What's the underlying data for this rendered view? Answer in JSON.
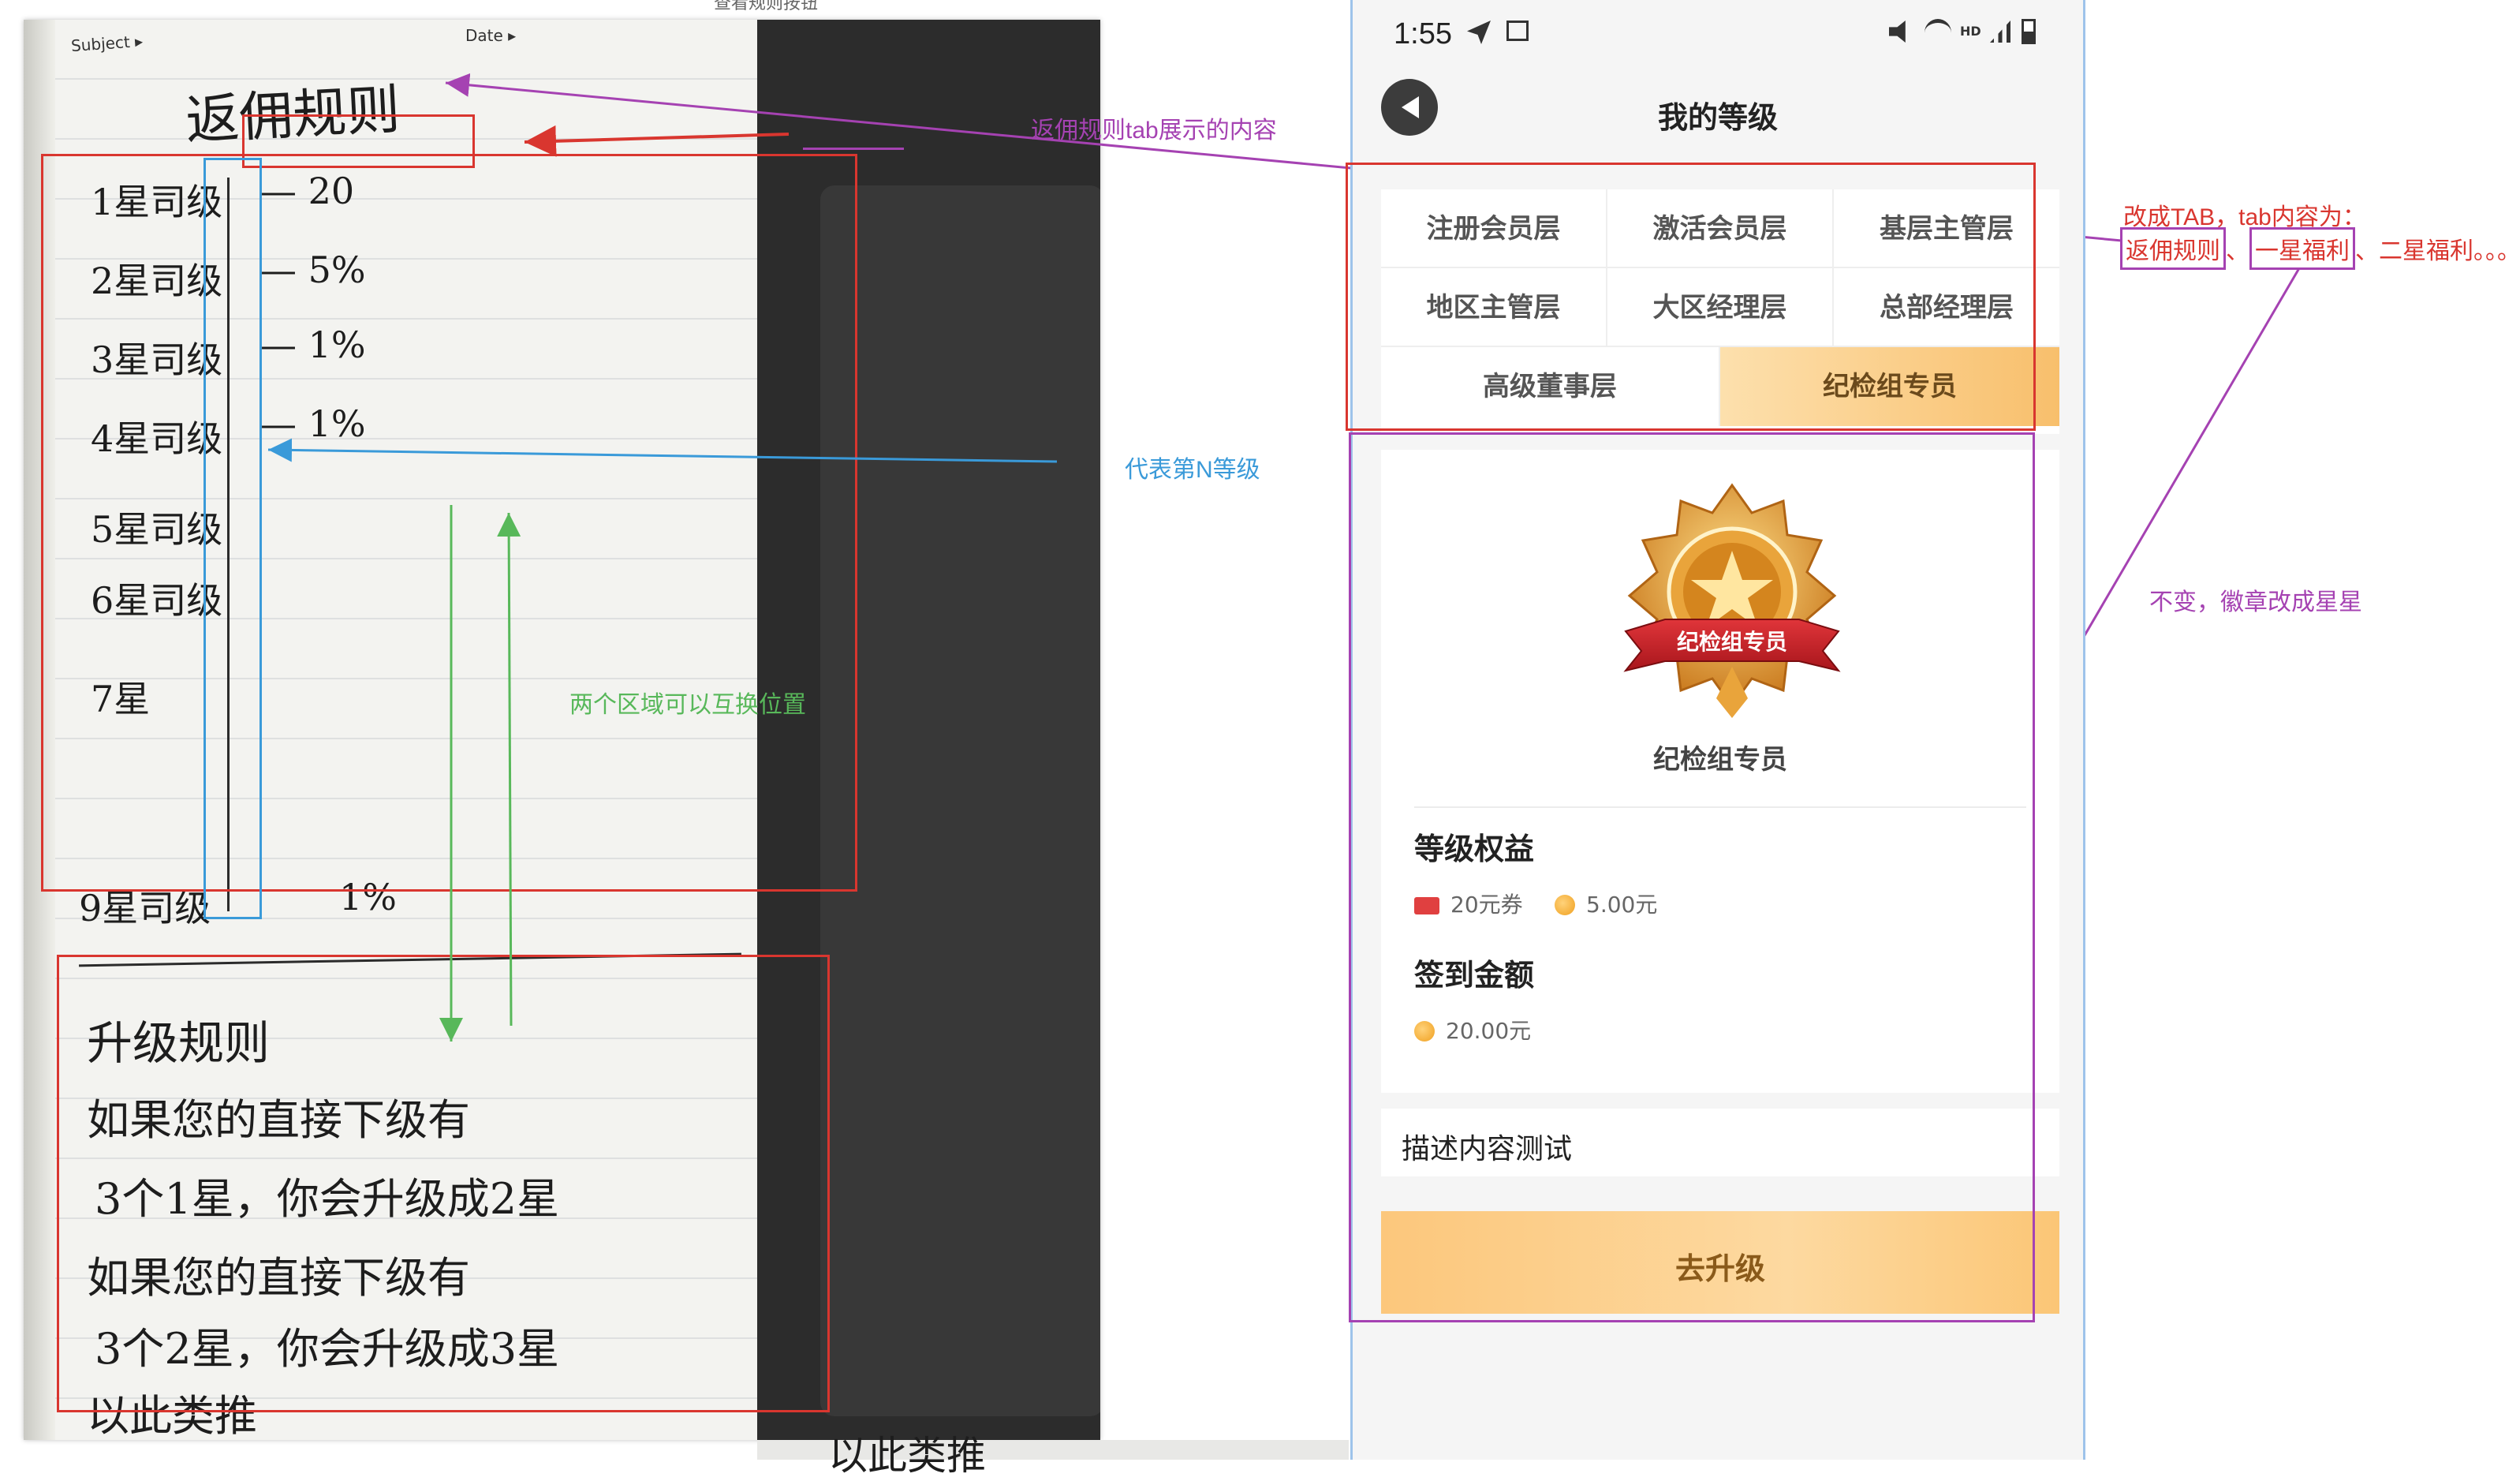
{
  "top_caption": "查看规则按钮",
  "notebook": {
    "subject_label": "Subject ▸",
    "date_label": "Date ▸",
    "heading": "返佣规则",
    "levels": [
      {
        "label": "1星司级",
        "value": "— 20"
      },
      {
        "label": "2星司级",
        "value": "— 5%"
      },
      {
        "label": "3星司级",
        "value": "— 1%"
      },
      {
        "label": "4星司级",
        "value": "— 1%"
      },
      {
        "label": "5星司级",
        "value": ""
      },
      {
        "label": "6星司级",
        "value": ""
      },
      {
        "label": "7星",
        "value": ""
      },
      {
        "label": "9星司级",
        "value": "1%"
      }
    ],
    "upgrade_heading": "升级规则",
    "upgrade_lines": [
      "如果您的直接下级有",
      "3个1星，你会升级成2星",
      "如果您的直接下级有",
      "3个2星，你会升级成3星",
      "以此类推"
    ],
    "bottom_partial": "以此类推"
  },
  "annotations": {
    "rule_tab_content": "返佣规则tab展示的内容",
    "nth_level": "代表第N等级",
    "swap_areas": "两个区域可以互换位置",
    "change_tab_line1": "改成TAB，tab内容为：",
    "change_tab_line2_parts": [
      "返佣规则",
      "、",
      "一星福利",
      "、二星福利。。。"
    ],
    "badge_note": "不变，徽章改成星星"
  },
  "phone": {
    "status": {
      "time": "1:55",
      "hd": "HD"
    },
    "title": "我的等级",
    "tabs": [
      {
        "label": "注册会员层",
        "active": false
      },
      {
        "label": "激活会员层",
        "active": false
      },
      {
        "label": "基层主管层",
        "active": false
      },
      {
        "label": "地区主管层",
        "active": false
      },
      {
        "label": "大区经理层",
        "active": false
      },
      {
        "label": "总部经理层",
        "active": false
      },
      {
        "label": "高级董事层",
        "active": false
      },
      {
        "label": "纪检组专员",
        "active": true
      }
    ],
    "badge": {
      "ribbon_text": "纪检组专员",
      "name": "纪检组专员"
    },
    "benefits_title": "等级权益",
    "benefit_items": [
      {
        "icon": "ticket-icon",
        "text": "20元券"
      },
      {
        "icon": "coin-icon",
        "text": "5.00元"
      }
    ],
    "checkin_title": "签到金额",
    "checkin_amount": "20.00元",
    "description": "描述内容测试",
    "upgrade_button": "去升级"
  },
  "colors": {
    "red": "#d9362f",
    "purple": "#a542b2",
    "blue": "#3a9ad9",
    "green": "#58b85a",
    "accent": "#f8bf6c"
  }
}
